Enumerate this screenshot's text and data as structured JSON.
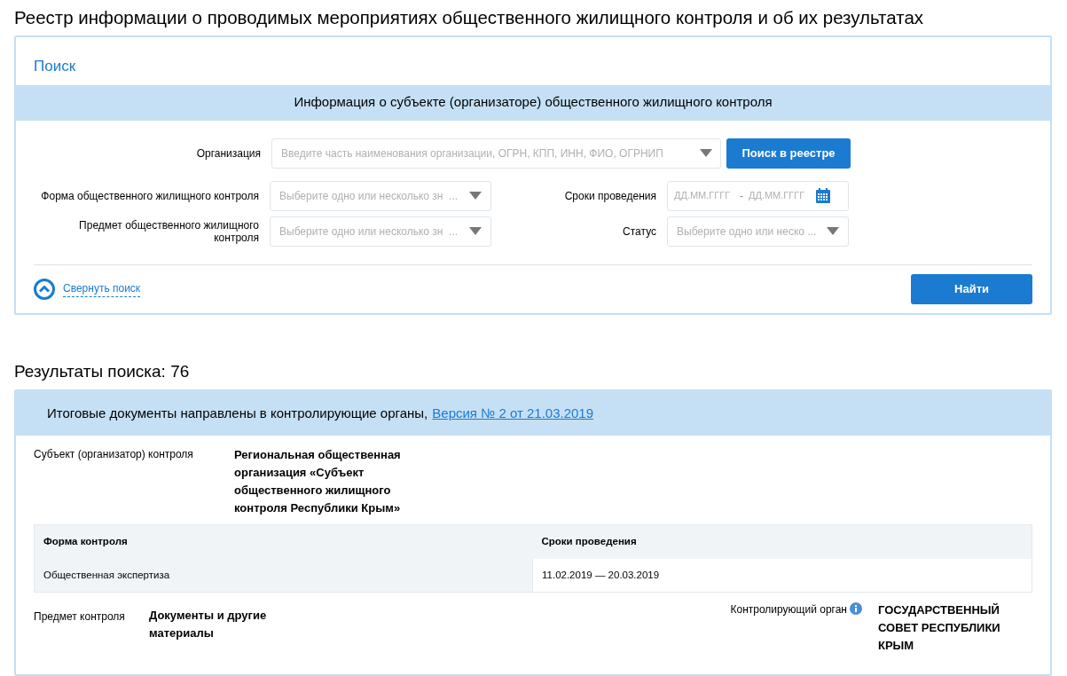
{
  "page_title": "Реестр информации о проводимых мероприятиях общественного жилищного контроля и об их результатах",
  "search": {
    "title": "Поиск",
    "section_header": "Информация о субъекте (организаторе) общественного жилищного контроля",
    "organization": {
      "label": "Организация",
      "placeholder": "Введите часть наименования организации, ОГРН, КПП, ИНН, ФИО, ОГРНИП"
    },
    "registry_button": "Поиск в реестре",
    "fields": [
      {
        "kind": "select",
        "label": "Форма общественного жилищного контроля",
        "placeholder": "Выберите одно или несколько зн  ..."
      },
      {
        "kind": "date_range",
        "label": "Сроки проведения",
        "from_placeholder": "ДД.ММ.ГГГГ",
        "separator": "-",
        "to_placeholder": "ДД.ММ.ГГГГ"
      },
      {
        "kind": "select",
        "label": "Предмет общественного жилищного контроля",
        "placeholder": "Выберите одно или несколько зн  ..."
      },
      {
        "kind": "select",
        "label": "Статус",
        "placeholder": "Выберите одно или неско ..."
      }
    ],
    "collapse_link": "Свернуть поиск",
    "find_button": "Найти"
  },
  "results": {
    "heading": "Результаты поиска: 76",
    "items": [
      {
        "status": "Итоговые документы направлены в контролирующие органы,",
        "version_link": "Версия № 2 от 21.03.2019",
        "subject_label": "Субъект (организатор) контроля",
        "subject_value": "Региональная общественная организация «Субъект общественного жилищного контроля Республики Крым»",
        "table": {
          "columns": [
            "Форма контроля",
            "Сроки проведения"
          ],
          "rows": [
            [
              "Общественная экспертиза",
              "11.02.2019 — 20.03.2019"
            ]
          ]
        },
        "matter_label": "Предмет контроля",
        "matter_value": "Документы и другие материалы",
        "authority_label": "Контролирующий орган",
        "authority_value": "ГОСУДАРСТВЕННЫЙ СОВЕТ РЕСПУБЛИКИ КРЫМ"
      }
    ]
  }
}
